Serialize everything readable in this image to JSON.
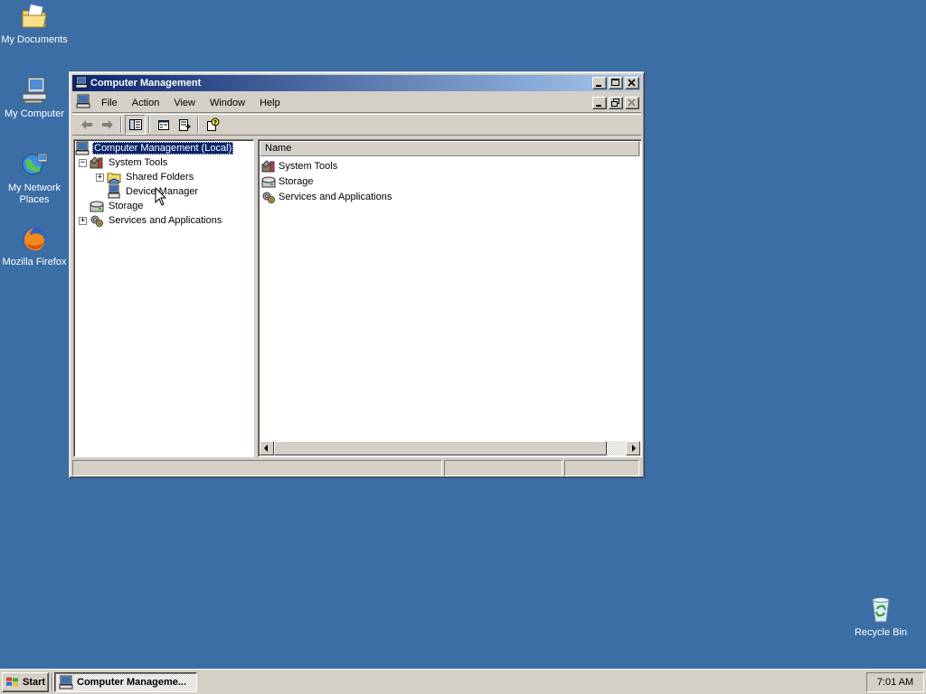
{
  "desktop": {
    "icons": [
      {
        "label": "My Documents",
        "icon": "my-documents-icon"
      },
      {
        "label": "My Computer",
        "icon": "my-computer-icon"
      },
      {
        "label": "My Network Places",
        "icon": "network-places-icon"
      },
      {
        "label": "Mozilla Firefox",
        "icon": "firefox-icon"
      },
      {
        "label": "Recycle Bin",
        "icon": "recycle-bin-icon"
      }
    ],
    "background_color": "#3a6ea5"
  },
  "window": {
    "title": "Computer Management",
    "menu": [
      "File",
      "Action",
      "View",
      "Window",
      "Help"
    ],
    "tree": {
      "root": "Computer Management (Local)",
      "items": [
        {
          "label": "System Tools",
          "expander": "−"
        },
        {
          "label": "Shared Folders",
          "expander": "+"
        },
        {
          "label": "Device Manager",
          "expander": ""
        },
        {
          "label": "Storage",
          "expander": ""
        },
        {
          "label": "Services and Applications",
          "expander": "+"
        }
      ]
    },
    "list": {
      "column": "Name",
      "rows": [
        "System Tools",
        "Storage",
        "Services and Applications"
      ]
    },
    "titlebar_color": "#0a246a"
  },
  "taskbar": {
    "start_label": "Start",
    "task_label": "Computer Manageme...",
    "clock": "7:01 AM"
  }
}
